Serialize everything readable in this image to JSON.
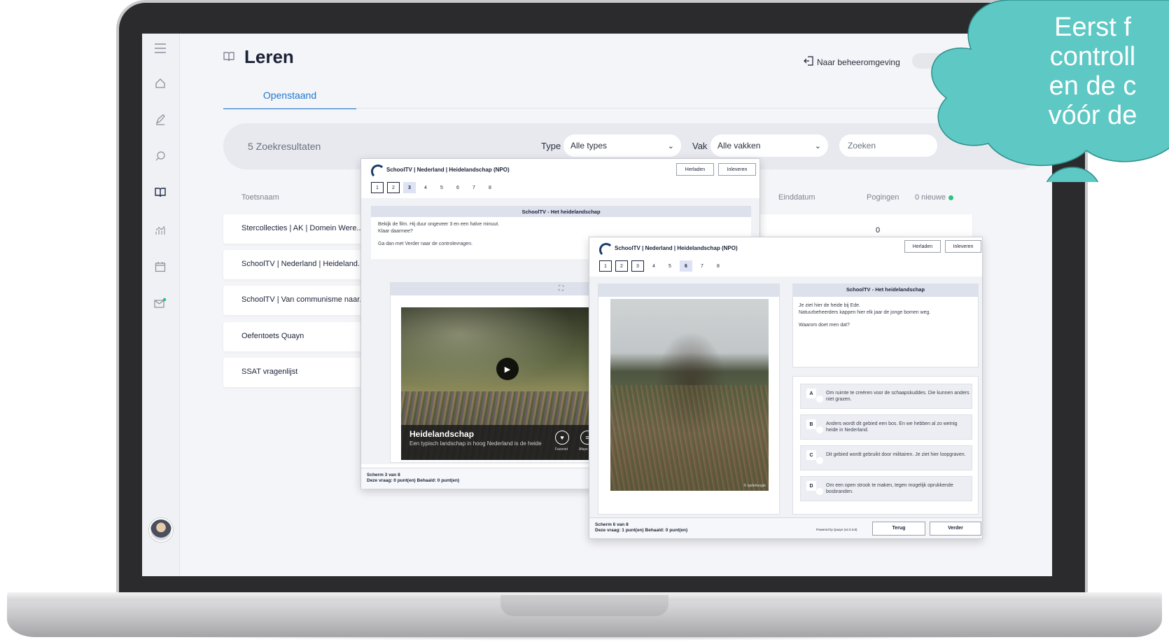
{
  "sidebar": {
    "icons": [
      "menu-icon",
      "home-icon",
      "pencil-icon",
      "chat-icon",
      "book-icon",
      "analytics-icon",
      "calendar-icon",
      "mail-icon"
    ]
  },
  "header": {
    "title": "Leren",
    "manage_link": "Naar beheeromgeving",
    "tab": "Openstaand"
  },
  "search": {
    "results": "5 Zoekresultaten",
    "type_label": "Type",
    "type_value": "Alle types",
    "vak_label": "Vak",
    "vak_value": "Alle vakken",
    "placeholder": "Zoeken"
  },
  "table": {
    "col_name": "Toetsnaam",
    "col_end": "Einddatum",
    "col_attempts": "Pogingen",
    "new_count": "0 nieuwe",
    "first_attempts": "0",
    "rows": [
      "Stercollecties | AK | Domein Were...",
      "SchoolTV | Nederland | Heideland...",
      "SchoolTV | Van communisme naar...",
      "Oefentoets Quayn",
      "SSAT vragenlijst"
    ]
  },
  "win1": {
    "title": "SchoolTV | Nederland | Heidelandschap (NPO)",
    "reload": "Herladen",
    "submit": "Inleveren",
    "pages": [
      "1",
      "2",
      "3",
      "4",
      "5",
      "6",
      "7",
      "8"
    ],
    "section": "SchoolTV - Het heidelandschap",
    "text1": "Bekijk de film. Hij duur ongeveer 3 en een halve minuut.",
    "text2": "Klaar daarmee?",
    "text3": "Ga dan met Verder naar de controlevragen.",
    "video_title": "Heidelandschap",
    "video_sub": "Een typisch landschap in hoog Nederland is de heide",
    "video_fav": "Favoriet",
    "video_list": "Afspe",
    "foot1": "Scherm 3 van 8",
    "foot2": "Deze vraag: 0 punt(en)   Behaald: 0 punt(en)"
  },
  "win2": {
    "title": "SchoolTV | Nederland | Heidelandschap (NPO)",
    "reload": "Herladen",
    "submit": "Inleveren",
    "pages": [
      "1",
      "2",
      "3",
      "4",
      "5",
      "6",
      "7",
      "8"
    ],
    "section": "SchoolTV - Het heidelandschap",
    "q1": "Je ziet hier de heide bij Ede.",
    "q2": "Natuurbeheerders kappen hier elk jaar de jonge bomen weg.",
    "q3": "Waarom doet men dat?",
    "photo_credit": "© opdehoogte",
    "answers": [
      {
        "letter": "A",
        "text": "Om ruimte te creëren voor de schaapskuddes. Die kunnen anders niet grazen."
      },
      {
        "letter": "B",
        "text": "Anders wordt dit gebied een bos. En we hebben al zo weinig heide in Nederland."
      },
      {
        "letter": "C",
        "text": "Dit gebied wordt gebruikt door militairen. Je ziet hier loopgraven."
      },
      {
        "letter": "D",
        "text": "Om een open strook te maken, tegen mogelijk oprukkende bosbranden."
      }
    ],
    "foot1": "Scherm 6 van 8",
    "foot2": "Deze vraag: 1 punt(en)   Behaald: 0 punt(en)",
    "powered": "Powered by Quayn (v2.0.3.8)",
    "back": "Terug",
    "next": "Verder"
  },
  "bubble": {
    "lines": [
      "Eerst f",
      "controll",
      "en de c",
      "vóór de"
    ],
    "color": "#5ec8c4"
  }
}
